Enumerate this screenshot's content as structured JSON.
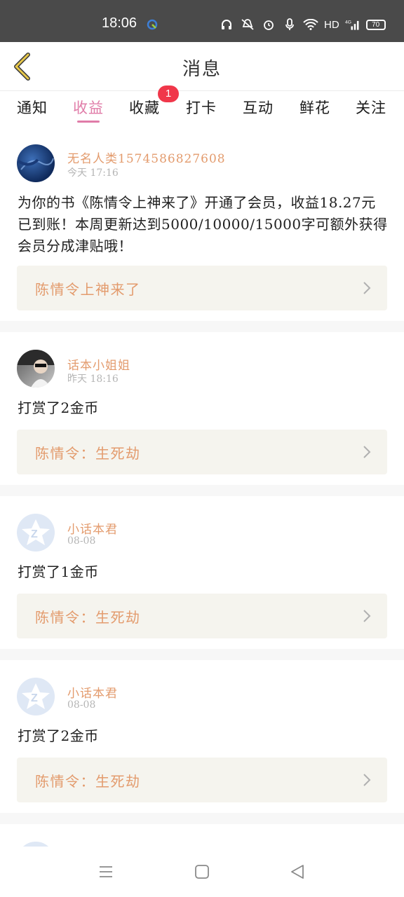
{
  "status_bar": {
    "time": "18:06",
    "hd": "HD",
    "network": "4G",
    "battery": "70"
  },
  "header": {
    "title": "消息"
  },
  "tabs": [
    {
      "label": "通知",
      "active": false
    },
    {
      "label": "收益",
      "active": true
    },
    {
      "label": "收藏",
      "active": false,
      "badge": "1"
    },
    {
      "label": "打卡",
      "active": false
    },
    {
      "label": "互动",
      "active": false
    },
    {
      "label": "鲜花",
      "active": false
    },
    {
      "label": "关注",
      "active": false
    }
  ],
  "messages": [
    {
      "user": "无名人类1574586827608",
      "time": "今天 17:16",
      "text": "为你的书《陈情令上神来了》开通了会员，收益18.27元已到账！本周更新达到5000/10000/15000字可额外获得会员分成津贴哦！",
      "book": "陈情令上神来了"
    },
    {
      "user": "话本小姐姐",
      "time": "昨天 18:16",
      "text": "打赏了2金币",
      "book": "陈情令：生死劫"
    },
    {
      "user": "小话本君",
      "time": "08-08",
      "text": "打赏了1金币",
      "book": "陈情令：生死劫"
    },
    {
      "user": "小话本君",
      "time": "08-08",
      "text": "打赏了2金币",
      "book": "陈情令：生死劫"
    }
  ],
  "colors": {
    "accent_pink": "#e07ca8",
    "username_orange": "#e39b6d",
    "badge_red": "#f0374a",
    "book_box_bg": "#f5f4ee"
  },
  "icons": [
    "back-chevron-icon",
    "chevron-right-icon",
    "menu-icon",
    "home-square-icon",
    "back-triangle-icon"
  ]
}
